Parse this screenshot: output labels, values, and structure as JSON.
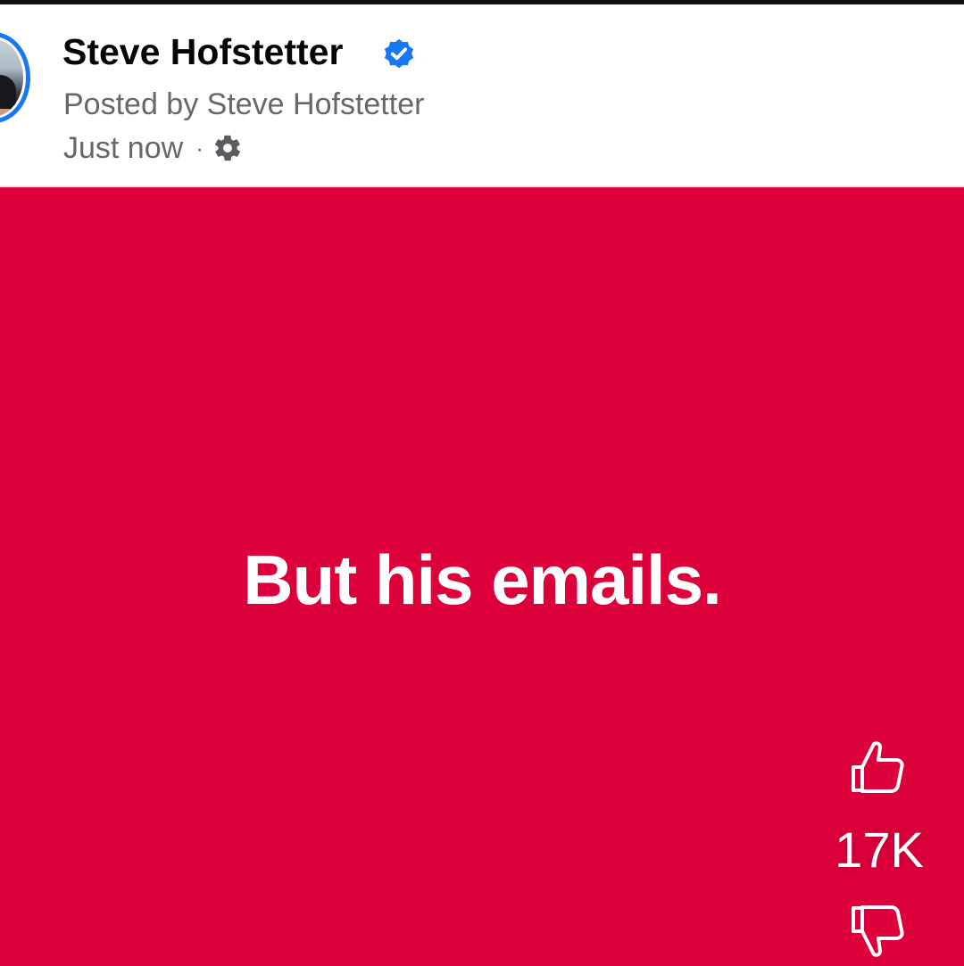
{
  "post": {
    "author": "Steve Hofstetter",
    "posted_by": "Posted by Steve Hofstetter",
    "timestamp": "Just now",
    "separator": "·",
    "audience_icon": "gear-icon",
    "verified_icon": "verified-badge-icon",
    "text": "But his emails.",
    "background_color": "#dc003b"
  },
  "reactions": {
    "like_icon": "thumbs-up-icon",
    "like_count": "17K",
    "dislike_icon": "thumbs-down-icon"
  },
  "colors": {
    "accent": "#1877f2",
    "name": "#050505",
    "secondary_text": "#65676b"
  }
}
